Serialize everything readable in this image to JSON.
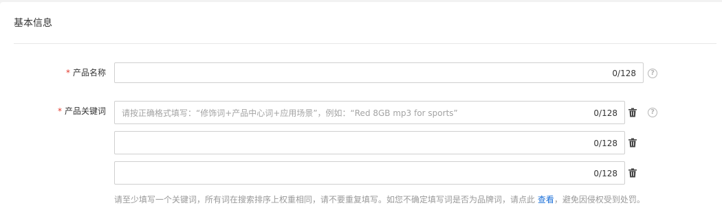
{
  "section": {
    "title": "基本信息"
  },
  "product_name": {
    "label": "产品名称",
    "required_mark": "*",
    "value": "",
    "counter": "0/128"
  },
  "keywords": {
    "label": "产品关键词",
    "required_mark": "*",
    "fields": [
      {
        "placeholder": "请按正确格式填写：“修饰词+产品中心词+应用场景”，例如：“Red 8GB mp3 for sports”",
        "counter": "0/128"
      },
      {
        "placeholder": "",
        "counter": "0/128"
      },
      {
        "placeholder": "",
        "counter": "0/128"
      }
    ],
    "hint_before": "请至少填写一个关键词，所有词在搜索排序上权重相同，请不要重复填写。如您不确定填写词是否为品牌词，请点此 ",
    "hint_link": "查看",
    "hint_after": "，避免因侵权受到处罚。"
  },
  "icons": {
    "help": "question-circle-icon",
    "trash": "trash-icon",
    "help_glyph": "?"
  },
  "colors": {
    "required": "#e23a2e",
    "link": "#1a6fd8",
    "border": "#cfcfcf",
    "background": "#f2f2f2"
  }
}
